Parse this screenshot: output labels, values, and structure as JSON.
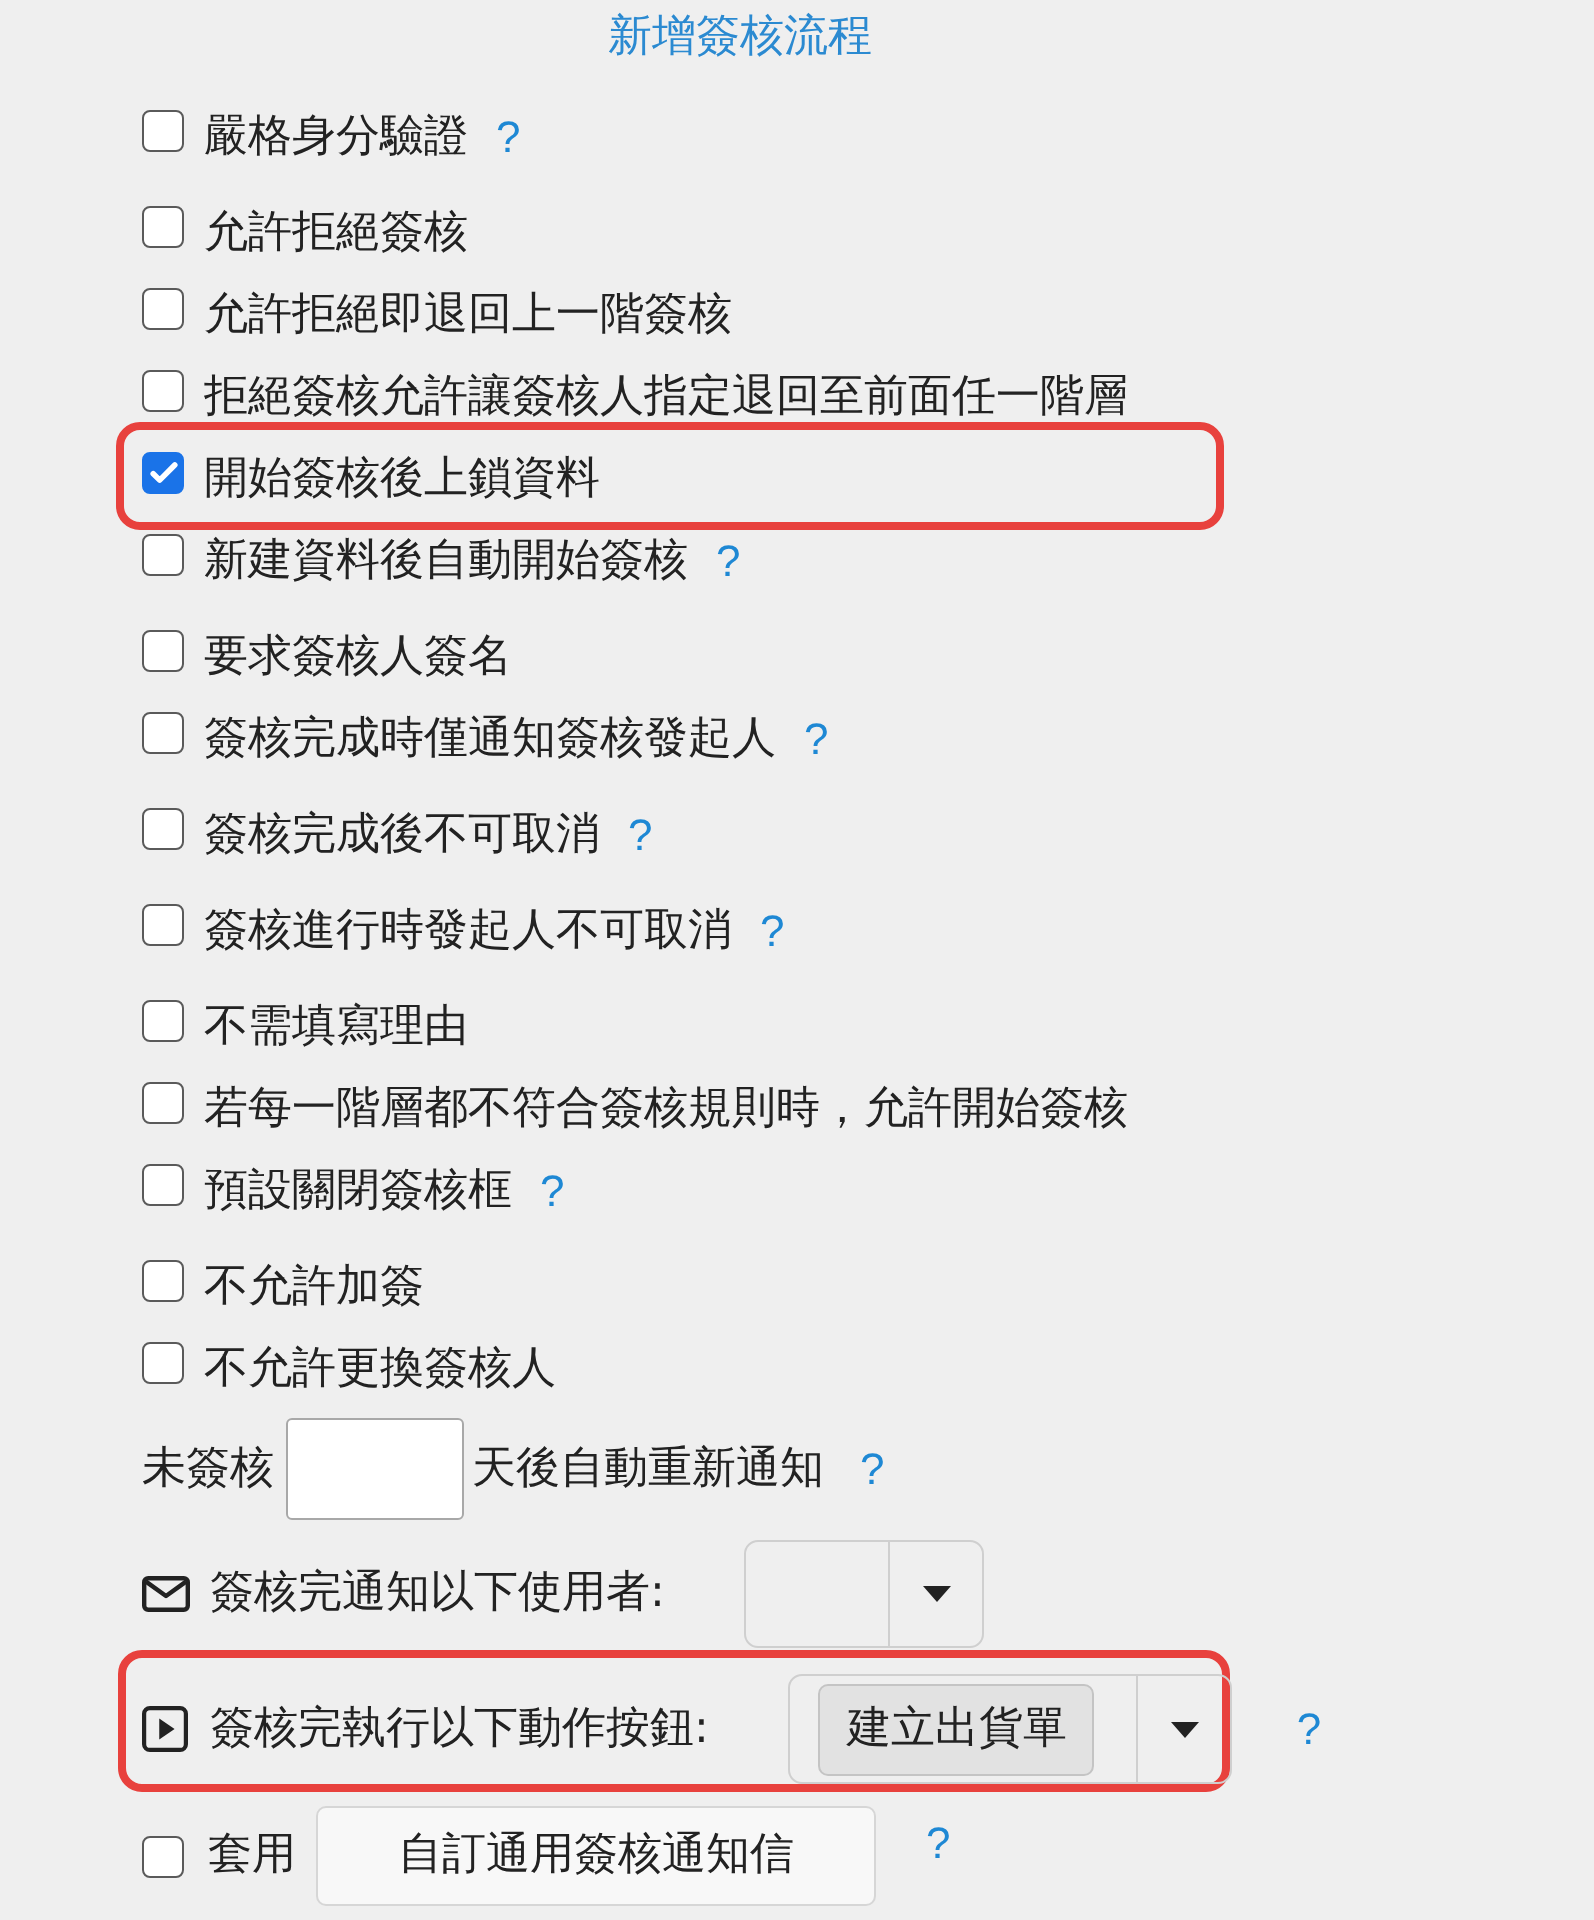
{
  "title": "新增簽核流程",
  "options": [
    {
      "label": "嚴格身分驗證",
      "checked": false,
      "highlighted": false,
      "help": "?"
    },
    {
      "label": "允許拒絕簽核",
      "checked": false,
      "highlighted": false
    },
    {
      "label": "允許拒絕即退回上一階簽核",
      "checked": false,
      "highlighted": false
    },
    {
      "label": "拒絕簽核允許讓簽核人指定退回至前面任一階層",
      "checked": false,
      "highlighted": false
    },
    {
      "label": "開始簽核後上鎖資料",
      "checked": true,
      "highlighted": true
    },
    {
      "label": "新建資料後自動開始簽核",
      "checked": false,
      "highlighted": false,
      "help": "?"
    },
    {
      "label": "要求簽核人簽名",
      "checked": false,
      "highlighted": false
    },
    {
      "label": "簽核完成時僅通知簽核發起人",
      "checked": false,
      "highlighted": false,
      "help": "?"
    },
    {
      "label": "簽核完成後不可取消",
      "checked": false,
      "highlighted": false,
      "help": "?"
    },
    {
      "label": "簽核進行時發起人不可取消",
      "checked": false,
      "highlighted": false,
      "help": "?"
    },
    {
      "label": "不需填寫理由",
      "checked": false,
      "highlighted": false
    },
    {
      "label": "若每一階層都不符合簽核規則時，允許開始簽核",
      "checked": false,
      "highlighted": false
    },
    {
      "label": "預設關閉簽核框",
      "checked": false,
      "highlighted": false,
      "help": "?"
    },
    {
      "label": "不允許加簽",
      "checked": false,
      "highlighted": false
    },
    {
      "label": "不允許更換簽核人",
      "checked": false,
      "highlighted": false
    }
  ],
  "reminder": {
    "prefix": "未簽核",
    "suffix": "天後自動重新通知",
    "help": "?"
  },
  "notify_users": {
    "label": "簽核完通知以下使用者:",
    "highlighted": false
  },
  "action_buttons": {
    "label": "簽核完執行以下動作按鈕:",
    "selected": [
      "建立出貨單"
    ],
    "highlighted": true,
    "help": "?"
  },
  "apply_template": {
    "label": "套用",
    "checked": false,
    "button": "自訂通用簽核通知信",
    "help": "?"
  }
}
